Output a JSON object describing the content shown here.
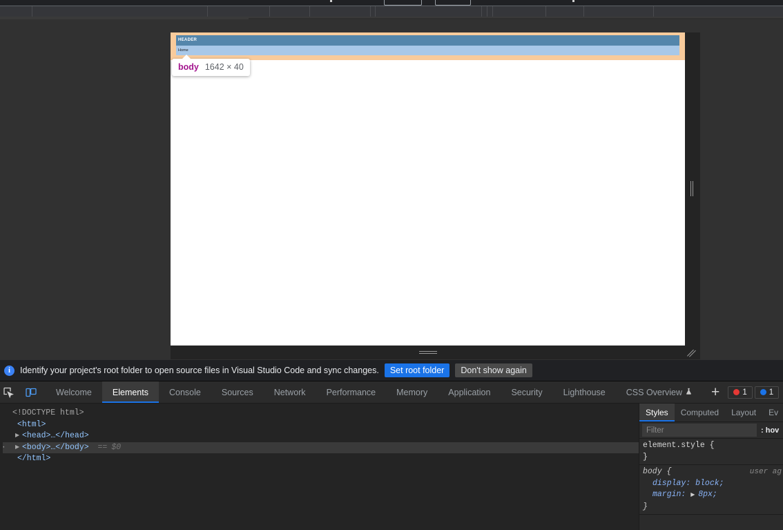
{
  "browser_page": {
    "highlighted_element": {
      "tag": "body",
      "dimensions": "1642 × 40",
      "tooltip_tag_color": "#a3158e"
    },
    "header_band_label": "HEADER",
    "nav_band_label": "Home",
    "colors": {
      "margin_highlight": "#f8cb9c",
      "header_dark": "#5486ab",
      "header_light": "#a8c8e8",
      "page_background": "#ffffff"
    }
  },
  "infobar": {
    "icon": "info-icon",
    "message": "Identify your project's root folder to open source files in Visual Studio Code and sync changes.",
    "primary_button": "Set root folder",
    "secondary_button": "Don't show again",
    "primary_color": "#1a73e8"
  },
  "devtools": {
    "left_icons": [
      {
        "name": "inspect-element-icon",
        "title": "Inspect element"
      },
      {
        "name": "device-toolbar-icon",
        "title": "Toggle device toolbar"
      }
    ],
    "tabs": [
      {
        "label": "Welcome",
        "active": false,
        "experimental": false
      },
      {
        "label": "Elements",
        "active": true,
        "experimental": false
      },
      {
        "label": "Console",
        "active": false,
        "experimental": false
      },
      {
        "label": "Sources",
        "active": false,
        "experimental": false
      },
      {
        "label": "Network",
        "active": false,
        "experimental": false
      },
      {
        "label": "Performance",
        "active": false,
        "experimental": false
      },
      {
        "label": "Memory",
        "active": false,
        "experimental": false
      },
      {
        "label": "Application",
        "active": false,
        "experimental": false
      },
      {
        "label": "Security",
        "active": false,
        "experimental": false
      },
      {
        "label": "Lighthouse",
        "active": false,
        "experimental": false
      },
      {
        "label": "CSS Overview",
        "active": false,
        "experimental": true
      }
    ],
    "add_tab_label": "+",
    "badges": [
      {
        "name": "error-badge",
        "count": "1",
        "color": "#e53935"
      },
      {
        "name": "message-badge",
        "count": "1",
        "color": "#1a73e8"
      }
    ],
    "dom_tree": [
      {
        "indent": 0,
        "triangle": "",
        "text": "<!DOCTYPE html>",
        "type": "doctype",
        "selected": false
      },
      {
        "indent": 1,
        "triangle": "",
        "text": "<html>",
        "type": "tag",
        "selected": false
      },
      {
        "indent": 2,
        "triangle": "▶",
        "text": "<head>…</head>",
        "type": "tag",
        "selected": false
      },
      {
        "indent": 2,
        "triangle": "▶",
        "text": "<body>…</body>",
        "type": "tag",
        "selected": true,
        "suffix_eq": "==",
        "suffix_var": "$0"
      },
      {
        "indent": 1,
        "triangle": "",
        "text": "</html>",
        "type": "tag",
        "selected": false
      }
    ],
    "styles_panel": {
      "tabs": [
        {
          "label": "Styles",
          "active": true
        },
        {
          "label": "Computed",
          "active": false
        },
        {
          "label": "Layout",
          "active": false
        },
        {
          "label": "Ev",
          "active": false
        }
      ],
      "filter_placeholder": "Filter",
      "filter_value": "",
      "hov_label": ": hov",
      "rules": [
        {
          "selector": "element.style {",
          "origin": "",
          "declarations": [],
          "close": "}",
          "is_ua": false
        },
        {
          "selector": "body {",
          "origin": "user ag",
          "declarations": [
            {
              "property": "display",
              "value": "block;",
              "expandable": false
            },
            {
              "property": "margin",
              "value": "8px;",
              "expandable": true
            }
          ],
          "close": "}",
          "is_ua": true
        }
      ]
    }
  }
}
